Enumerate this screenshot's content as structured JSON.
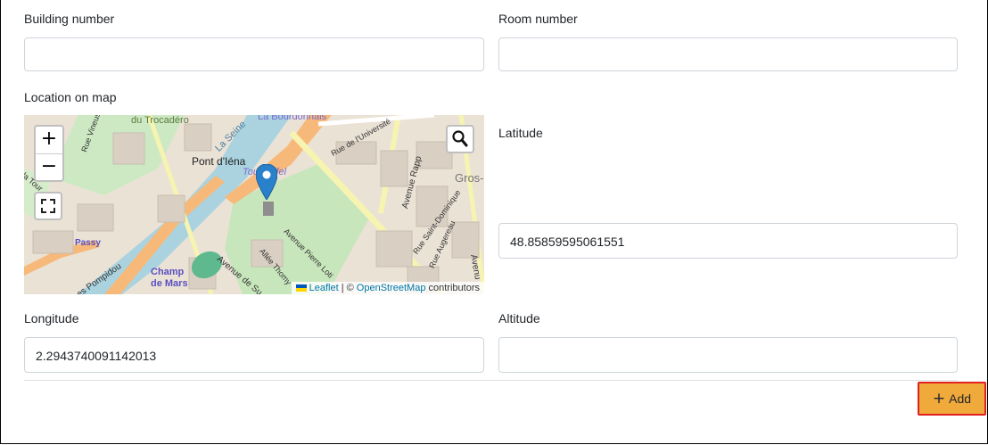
{
  "form": {
    "building_number": {
      "label": "Building number",
      "value": ""
    },
    "room_number": {
      "label": "Room number",
      "value": ""
    },
    "location": {
      "label": "Location on map"
    },
    "latitude": {
      "label": "Latitude",
      "value": "48.85859595061551"
    },
    "longitude": {
      "label": "Longitude",
      "value": "2.2943740091142013"
    },
    "altitude": {
      "label": "Altitude",
      "value": ""
    }
  },
  "map": {
    "zoom_in": "+",
    "zoom_out": "−",
    "fullscreen_icon": "fullscreen-icon",
    "search_icon": "search-icon",
    "marker_icon": "map-marker-icon",
    "places": {
      "trocadero": "du Trocadéro",
      "bourdonnais": "La Bourdonnais",
      "pont_iena": "Pont d'Iéna",
      "tour_eiffel": "Tour Eiffel",
      "seine": "La Seine",
      "rue_universite": "Rue de l'Université",
      "avenue_rapp": "Avenue Rapp",
      "gros": "Gros-",
      "passy": "Passy",
      "champ_de_mars": "Champ de Mars",
      "avenue_pierre_loti": "Avenue Pierre Loti",
      "allee_thomy": "Allée Thomy",
      "avenue_suffren": "Avenue de Su",
      "saint_dominique": "Rue Saint-Dominique",
      "augereau": "Rue Augereau",
      "pompidou": "es Pompidou",
      "la_tour": "la Tour",
      "vineuse": "Rue Vineuse",
      "avenue": "Avenu"
    },
    "attribution": {
      "leaflet": "Leaflet",
      "separator": "| ©",
      "osm": "OpenStreetMap",
      "contributors": "contributors"
    }
  },
  "actions": {
    "add_label": "Add",
    "add_icon": "plus-icon"
  }
}
